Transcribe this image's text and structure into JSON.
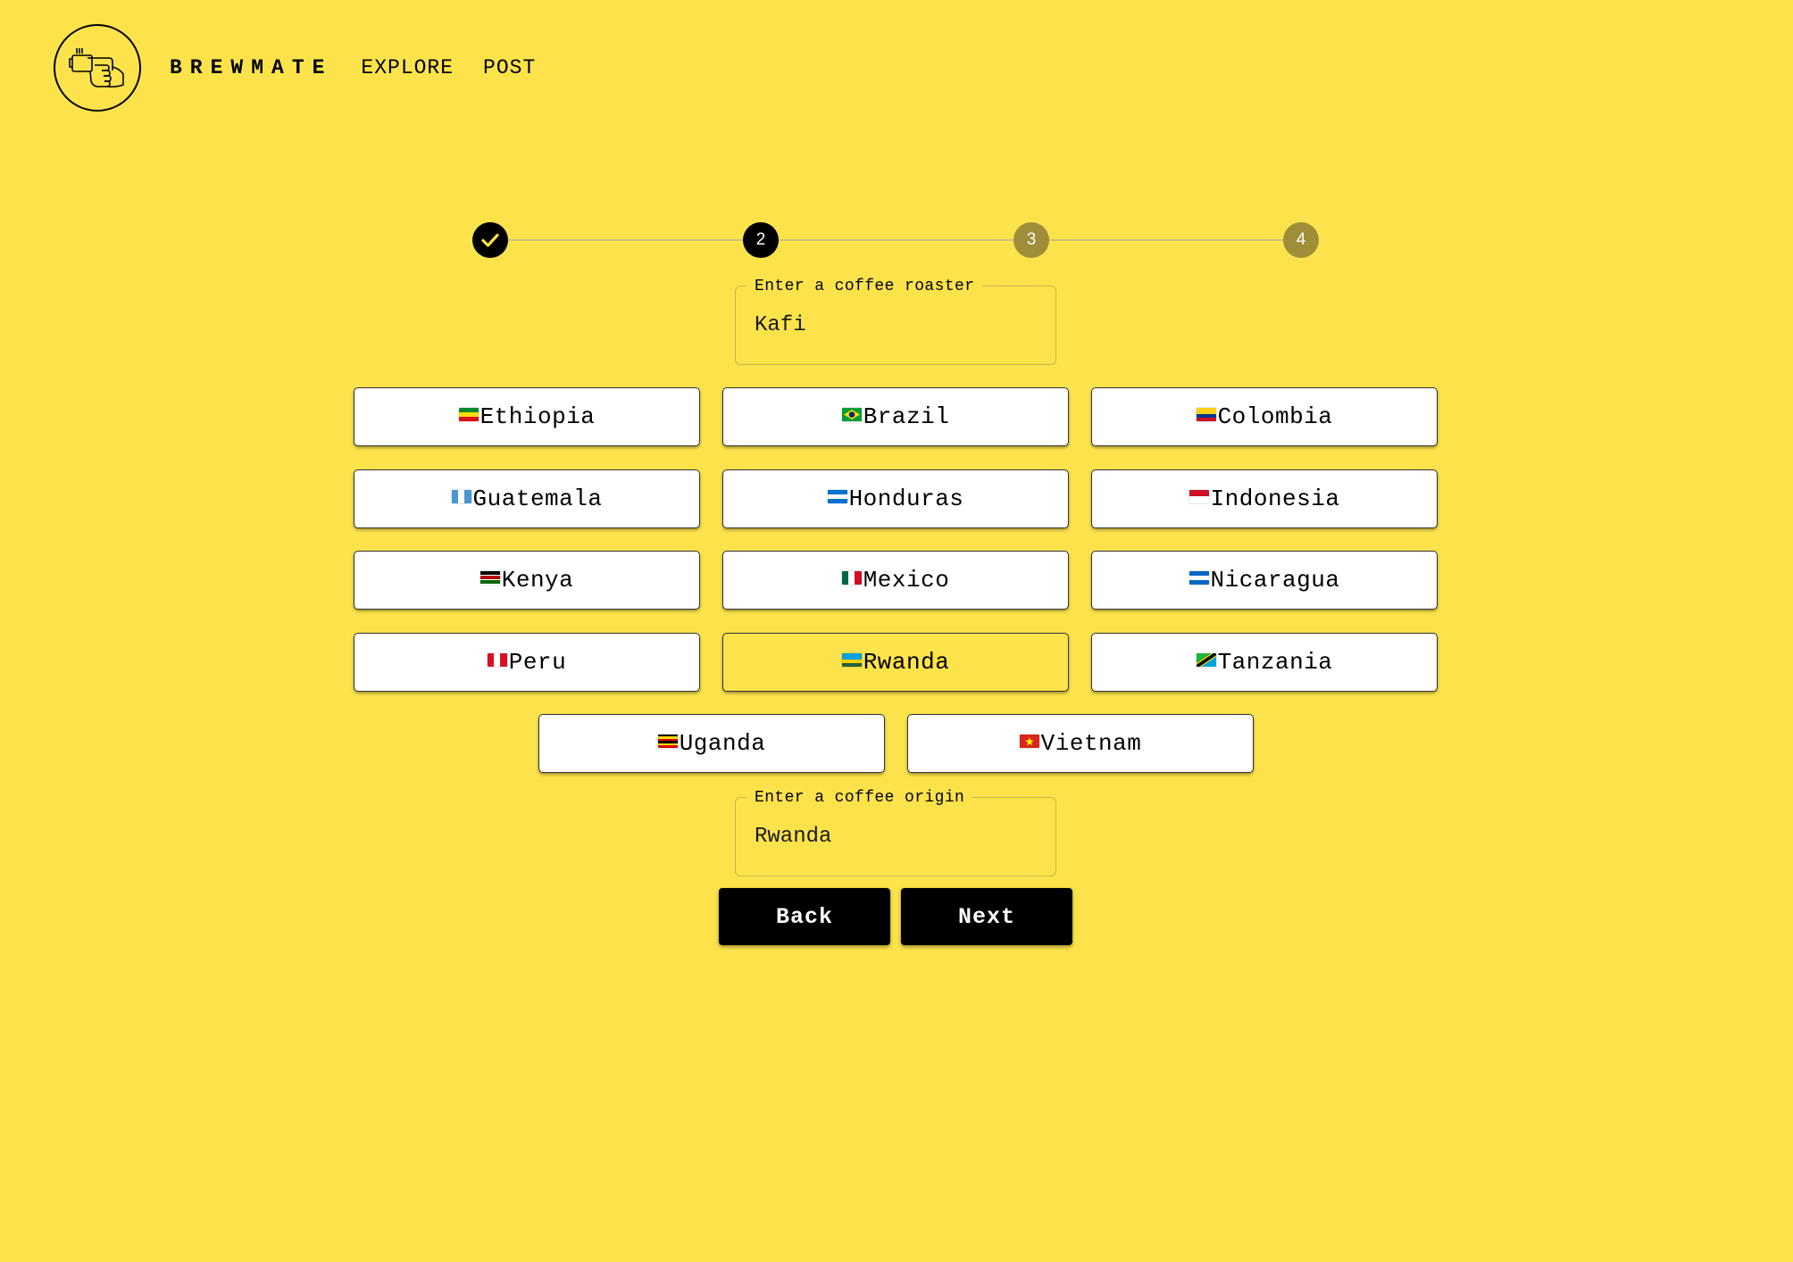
{
  "header": {
    "brand": "BREWMATE",
    "nav": {
      "explore": "EXPLORE",
      "post": "POST"
    },
    "logo_icon": "coffee-cup-hand-icon"
  },
  "stepper": {
    "current_step": 2,
    "steps": [
      {
        "label": "",
        "state": "completed",
        "icon": "check-icon"
      },
      {
        "label": "2",
        "state": "active"
      },
      {
        "label": "3",
        "state": "pending"
      },
      {
        "label": "4",
        "state": "pending"
      }
    ]
  },
  "roaster_field": {
    "label": "Enter a coffee roaster",
    "value": "Kafi"
  },
  "origins": {
    "selected": "Rwanda",
    "options": [
      {
        "label": "Ethiopia",
        "flag_colors": [
          "#078930",
          "#FCDD09",
          "#DA121A"
        ]
      },
      {
        "label": "Brazil",
        "flag_colors": [
          "#009C3B",
          "#FFDF00",
          "#002776"
        ]
      },
      {
        "label": "Colombia",
        "flag_colors": [
          "#FCD116",
          "#003893",
          "#CE1126"
        ]
      },
      {
        "label": "Guatemala",
        "flag_colors": [
          "#4997D0",
          "#FFFFFF",
          "#4997D0"
        ]
      },
      {
        "label": "Honduras",
        "flag_colors": [
          "#0073CF",
          "#FFFFFF",
          "#0073CF"
        ]
      },
      {
        "label": "Indonesia",
        "flag_colors": [
          "#CE1126",
          "#FFFFFF"
        ]
      },
      {
        "label": "Kenya",
        "flag_colors": [
          "#000000",
          "#BB0000",
          "#006600"
        ]
      },
      {
        "label": "Mexico",
        "flag_colors": [
          "#006847",
          "#FFFFFF",
          "#CE1126"
        ]
      },
      {
        "label": "Nicaragua",
        "flag_colors": [
          "#0067C6",
          "#FFFFFF",
          "#0067C6"
        ]
      },
      {
        "label": "Peru",
        "flag_colors": [
          "#D91023",
          "#FFFFFF",
          "#D91023"
        ]
      },
      {
        "label": "Rwanda",
        "flag_colors": [
          "#00A1DE",
          "#00A1DE",
          "#FAD201",
          "#20603D"
        ]
      },
      {
        "label": "Tanzania",
        "flag_colors": [
          "#1EB53A",
          "#000000",
          "#00A3DD"
        ]
      },
      {
        "label": "Uganda",
        "flag_colors": [
          "#000000",
          "#FCDC04",
          "#D90000",
          "#000000",
          "#FCDC04",
          "#D90000"
        ]
      },
      {
        "label": "Vietnam",
        "flag_colors": [
          "#DA251D"
        ]
      }
    ]
  },
  "origin_field": {
    "label": "Enter a coffee origin",
    "value": "Rwanda"
  },
  "actions": {
    "back": "Back",
    "next": "Next"
  },
  "colors": {
    "background": "#FCE34B",
    "primary_button": "#000000",
    "pending_step": "#9E8E3A",
    "option_background": "#FFFFFF"
  }
}
